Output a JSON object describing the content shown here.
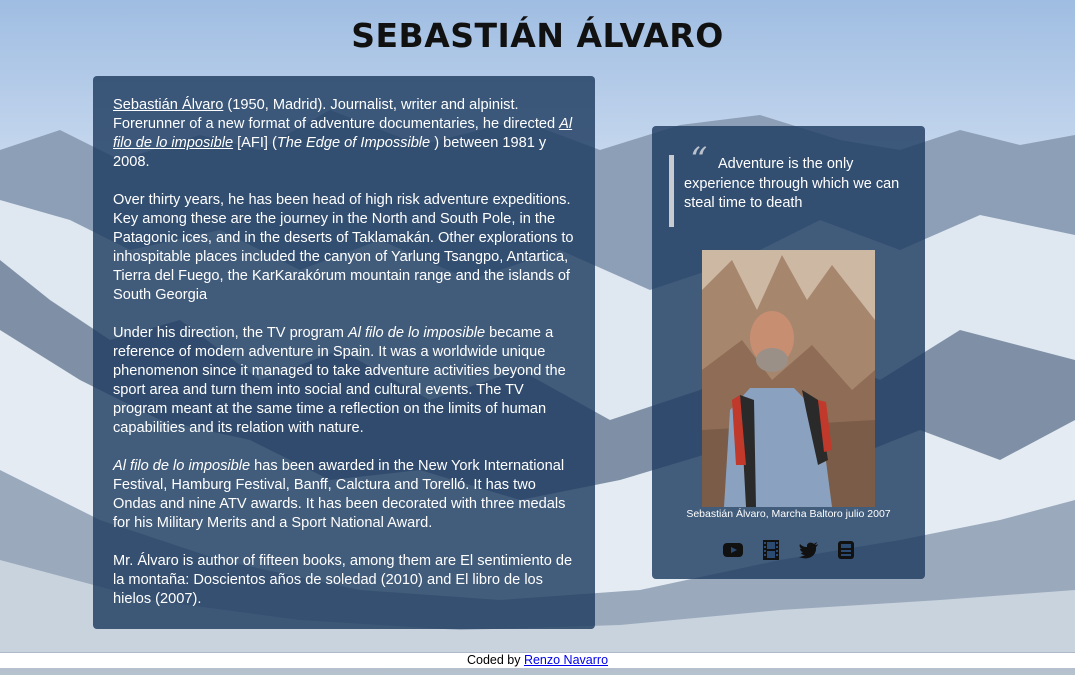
{
  "header": {
    "title": "SEBASTIÁN ÁLVARO"
  },
  "bio": {
    "p1": {
      "name_link": "Sebastián Álvaro",
      "t1": " (1950, Madrid). Journalist, writer and alpinist. Forerunner of a new format of adventure documentaries, he directed ",
      "show_link": "Al filo de lo imposible",
      "t2": " [AFI] (",
      "show_en": "The Edge of Impossible",
      "t3": " ) between 1981 y 2008."
    },
    "p2": "Over thirty years, he has been head of high risk adventure expeditions. Key among these are the journey in the North and South Pole, in the Patagonic ices, and in the deserts of Taklamakán. Other explorations to inhospitable places included the canyon of Yarlung Tsangpo, Antartica, Tierra del Fuego, the KarKarakórum mountain range and the islands of South Georgia",
    "p3": {
      "t1": "Under his direction, the TV program ",
      "show": "Al filo de lo imposible",
      "t2": " became a reference of modern adventure in Spain. It was a worldwide unique phenomenon since it managed to take adventure activities beyond the sport area and turn them into social and cultural events. The TV program meant at the same time a reflection on the limits of human capabilities and its relation with nature."
    },
    "p4": {
      "show": "Al filo de lo imposible",
      "t1": " has been awarded in the New York International Festival, Hamburg Festival, Banff, Calctura and Torelló. It has two Ondas and nine ATV awards. It has been decorated with three medals for his Military Merits and a Sport National Award."
    },
    "p5": "Mr. Álvaro is author of fifteen books, among them are El sentimiento de la montaña: Doscientos años de soledad (2010) and El libro de los hielos (2007)."
  },
  "side": {
    "quote_mark": "“",
    "quote": "Adventure is the only experience through which we can steal time to death",
    "caption": "Sebastián Álvaro, Marcha Baltoro julio 2007",
    "icons": [
      "youtube-icon",
      "film-icon",
      "twitter-icon",
      "blog-icon"
    ]
  },
  "footer": {
    "text": "Coded by ",
    "author": "Renzo Navarro"
  }
}
